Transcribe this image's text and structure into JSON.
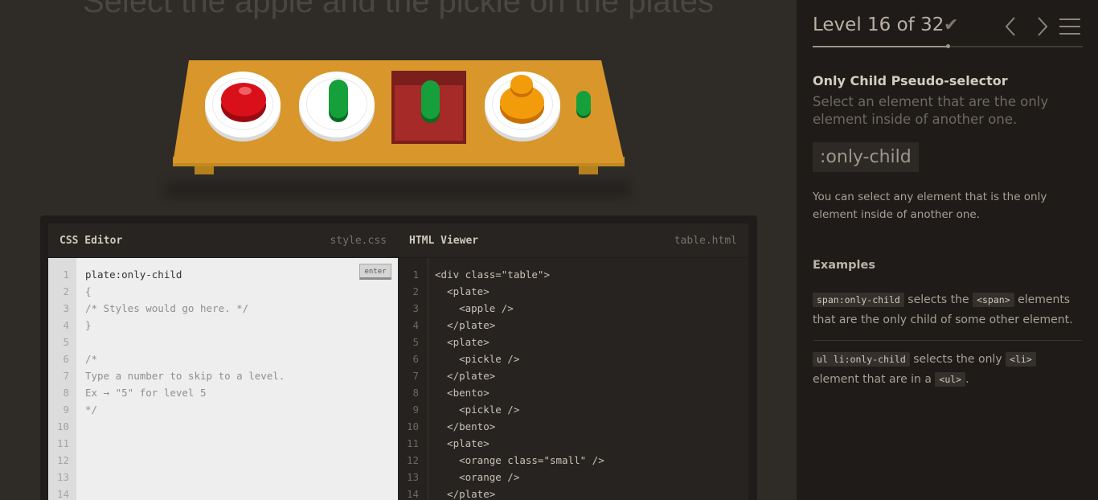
{
  "game": {
    "instruction": "Select the apple and the pickle on the plates"
  },
  "css_editor": {
    "title": "CSS Editor",
    "filename": "style.css",
    "enter_label": "enter",
    "lines": [
      {
        "n": "1",
        "text": "plate:only-child",
        "style": "input"
      },
      {
        "n": "2",
        "text": "{",
        "style": "muted"
      },
      {
        "n": "3",
        "text": "/* Styles would go here. */",
        "style": "muted"
      },
      {
        "n": "4",
        "text": "}",
        "style": "muted"
      },
      {
        "n": "5",
        "text": "",
        "style": "muted"
      },
      {
        "n": "6",
        "text": "/*",
        "style": "muted"
      },
      {
        "n": "7",
        "text": "Type a number to skip to a level.",
        "style": "muted"
      },
      {
        "n": "8",
        "text": "Ex → \"5\" for level 5",
        "style": "muted"
      },
      {
        "n": "9",
        "text": "*/",
        "style": "muted"
      },
      {
        "n": "10",
        "text": "",
        "style": "muted"
      },
      {
        "n": "11",
        "text": "",
        "style": "muted"
      },
      {
        "n": "12",
        "text": "",
        "style": "muted"
      },
      {
        "n": "13",
        "text": "",
        "style": "muted"
      },
      {
        "n": "14",
        "text": "",
        "style": "muted"
      }
    ]
  },
  "html_viewer": {
    "title": "HTML Viewer",
    "filename": "table.html",
    "lines": [
      {
        "n": "1",
        "text": "<div class=\"table\">"
      },
      {
        "n": "2",
        "text": "  <plate>"
      },
      {
        "n": "3",
        "text": "    <apple />"
      },
      {
        "n": "4",
        "text": "  </plate>"
      },
      {
        "n": "5",
        "text": "  <plate>"
      },
      {
        "n": "6",
        "text": "    <pickle />"
      },
      {
        "n": "7",
        "text": "  </plate>"
      },
      {
        "n": "8",
        "text": "  <bento>"
      },
      {
        "n": "9",
        "text": "    <pickle />"
      },
      {
        "n": "10",
        "text": "  </bento>"
      },
      {
        "n": "11",
        "text": "  <plate>"
      },
      {
        "n": "12",
        "text": "    <orange class=\"small\" />"
      },
      {
        "n": "13",
        "text": "    <orange />"
      },
      {
        "n": "14",
        "text": "  </plate>"
      }
    ]
  },
  "sidebar": {
    "level_label": "Level 16 of 32",
    "check_icon": "check-icon",
    "progress_fraction": 0.5,
    "selector_name": "Only Child Pseudo-selector",
    "selector_title": "Select an element that are the only element inside of another one.",
    "syntax": ":only-child",
    "description": "You can select any element that is the only element inside of another one.",
    "examples_heading": "Examples",
    "example1": {
      "code": "span:only-child",
      "t1": " selects the ",
      "tag": "<span>",
      "t2": " elements that are the only child of some other element."
    },
    "example2": {
      "code": "ul li:only-child",
      "t1": " selects the only ",
      "tag": "<li>",
      "t2": " element that are in a ",
      "tag2": "<ul>",
      "t3": "."
    }
  },
  "colors": {
    "background": "#2f2c28",
    "sidebar": "#1e1b18",
    "table": "#d8962b",
    "apple": "#d9101a",
    "pickle": "#16a03c",
    "orange": "#f39c0b",
    "bento": "#a62a27"
  }
}
